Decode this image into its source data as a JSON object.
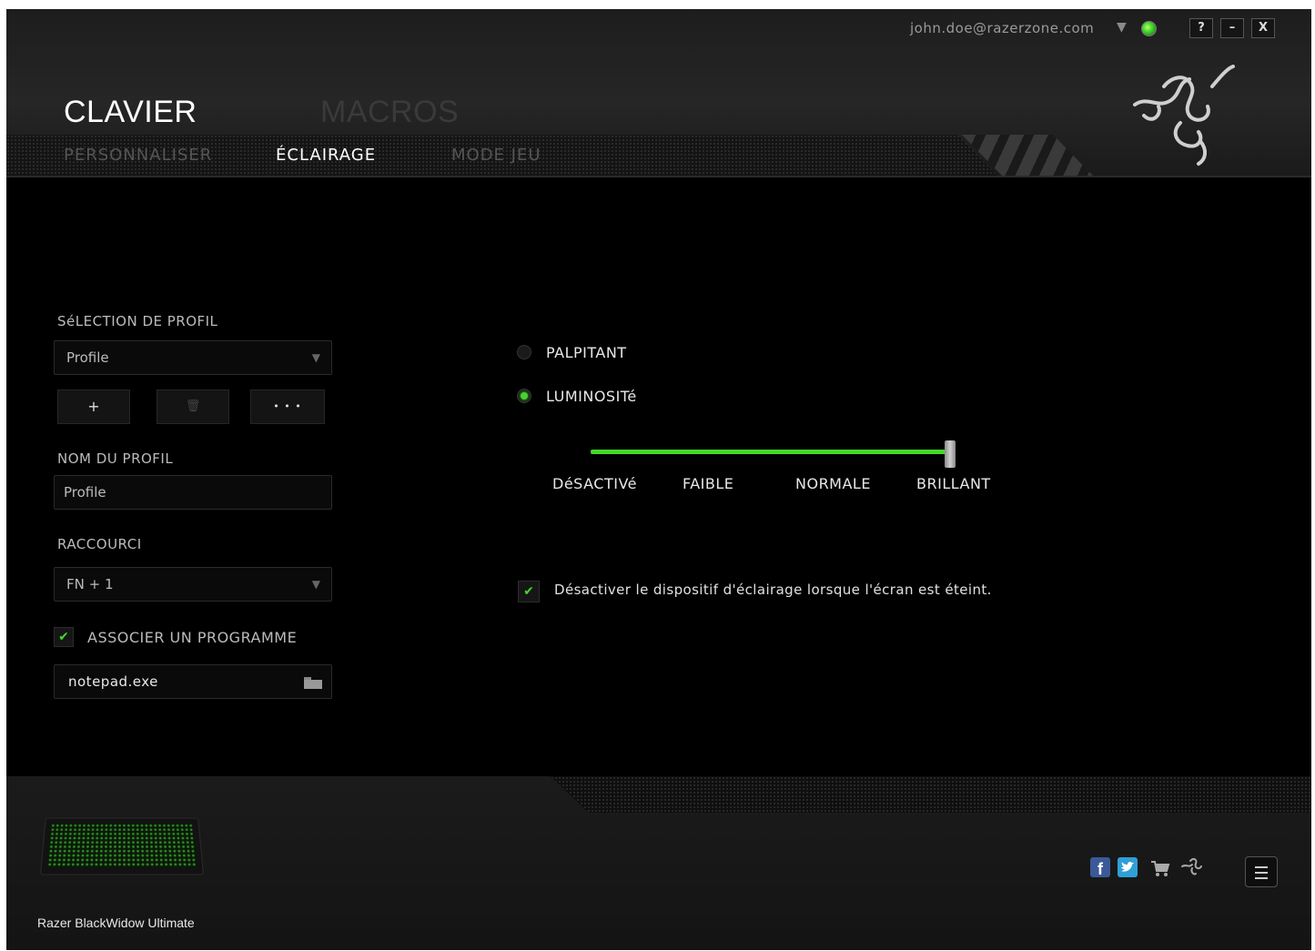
{
  "header": {
    "account_email": "john.doe@razerzone.com",
    "main_tabs": [
      {
        "label": "CLAVIER",
        "active": true
      },
      {
        "label": "MACROS",
        "active": false
      }
    ],
    "sub_tabs": [
      {
        "label": "PERSONNALISER",
        "active": false
      },
      {
        "label": "ÉCLAIRAGE",
        "active": true
      },
      {
        "label": "MODE JEU",
        "active": false
      }
    ],
    "window_buttons": [
      "?",
      "–",
      "X"
    ],
    "status_color": "#44d62c"
  },
  "profile": {
    "selection_label": "SéLECTION DE PROFIL",
    "selected_profile": "Profile",
    "add_button": "+",
    "delete_button": "🗑",
    "more_button": "• • •",
    "name_label": "NOM DU PROFIL",
    "name_value": "Profile",
    "shortcut_label": "RACCOURCI",
    "shortcut_value": "FN + 1",
    "link_program_label": "ASSOCIER UN PROGRAMME",
    "link_program_checked": true,
    "program_value": "notepad.exe"
  },
  "lighting": {
    "options": [
      {
        "label": "PALPITANT",
        "selected": false
      },
      {
        "label": "LUMINOSITé",
        "selected": true
      }
    ],
    "brightness_levels": [
      "DéSACTIVé",
      "FAIBLE",
      "NORMALE",
      "BRILLANT"
    ],
    "brightness_value": "BRILLANT",
    "brightness_fraction": 1.0,
    "screen_off_checkbox_label": "Désactiver le dispositif d'éclairage lorsque l'écran est éteint.",
    "screen_off_checked": true
  },
  "footer": {
    "device_name": "Razer BlackWidow Ultimate",
    "icons": [
      "facebook-icon",
      "twitter-icon",
      "store-cart-icon",
      "razer-insider-icon",
      "menu-icon"
    ]
  },
  "colors": {
    "accent_green": "#44d62c",
    "background": "#000000"
  }
}
